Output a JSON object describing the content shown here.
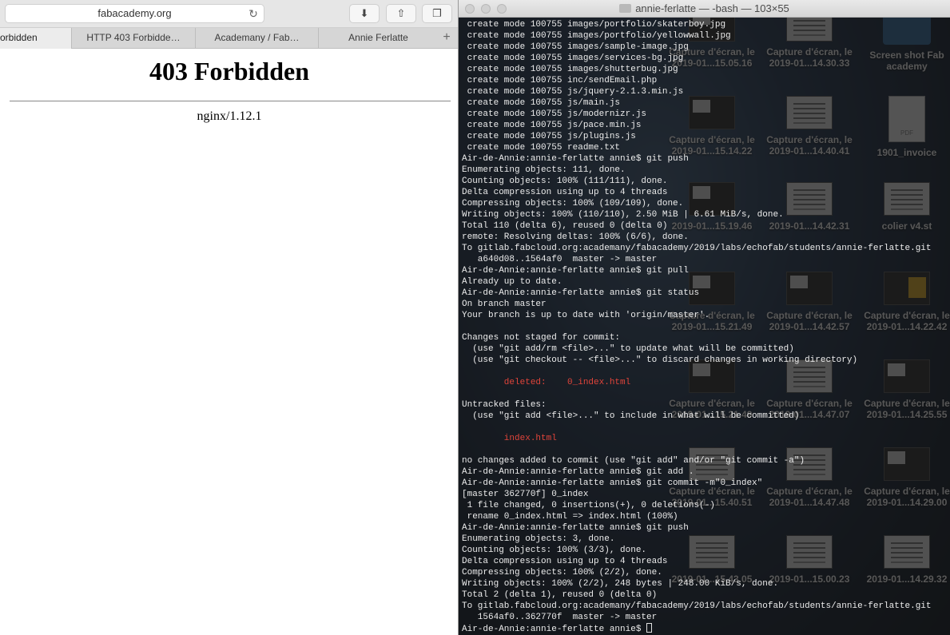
{
  "browser": {
    "address": "fabacademy.org",
    "tabs": [
      {
        "label": "orbidden",
        "active": true
      },
      {
        "label": "HTTP 403 Forbidde…",
        "active": false
      },
      {
        "label": "Academany / Fab…",
        "active": false
      },
      {
        "label": "Annie Ferlatte",
        "active": false
      }
    ],
    "add_tab": "+",
    "page": {
      "title": "403 Forbidden",
      "server": "nginx/1.12.1"
    }
  },
  "terminal": {
    "title": "annie-ferlatte — -bash — 103×55",
    "lines": [
      {
        "text": " create mode 100755 images/portfolio/skaterboy.jpg"
      },
      {
        "text": " create mode 100755 images/portfolio/yellowwall.jpg"
      },
      {
        "text": " create mode 100755 images/sample-image.jpg"
      },
      {
        "text": " create mode 100755 images/services-bg.jpg"
      },
      {
        "text": " create mode 100755 images/shutterbug.jpg"
      },
      {
        "text": " create mode 100755 inc/sendEmail.php"
      },
      {
        "text": " create mode 100755 js/jquery-2.1.3.min.js"
      },
      {
        "text": " create mode 100755 js/main.js"
      },
      {
        "text": " create mode 100755 js/modernizr.js"
      },
      {
        "text": " create mode 100755 js/pace.min.js"
      },
      {
        "text": " create mode 100755 js/plugins.js"
      },
      {
        "text": " create mode 100755 readme.txt"
      },
      {
        "text": "Air-de-Annie:annie-ferlatte annie$ git push"
      },
      {
        "text": "Enumerating objects: 111, done."
      },
      {
        "text": "Counting objects: 100% (111/111), done."
      },
      {
        "text": "Delta compression using up to 4 threads"
      },
      {
        "text": "Compressing objects: 100% (109/109), done."
      },
      {
        "text": "Writing objects: 100% (110/110), 2.50 MiB | 6.61 MiB/s, done."
      },
      {
        "text": "Total 110 (delta 6), reused 0 (delta 0)"
      },
      {
        "text": "remote: Resolving deltas: 100% (6/6), done."
      },
      {
        "text": "To gitlab.fabcloud.org:academany/fabacademy/2019/labs/echofab/students/annie-ferlatte.git"
      },
      {
        "text": "   a640d08..1564af0  master -> master"
      },
      {
        "text": "Air-de-Annie:annie-ferlatte annie$ git pull"
      },
      {
        "text": "Already up to date."
      },
      {
        "text": "Air-de-Annie:annie-ferlatte annie$ git status"
      },
      {
        "text": "On branch master"
      },
      {
        "text": "Your branch is up to date with 'origin/master'."
      },
      {
        "text": ""
      },
      {
        "text": "Changes not staged for commit:"
      },
      {
        "text": "  (use \"git add/rm <file>...\" to update what will be committed)"
      },
      {
        "text": "  (use \"git checkout -- <file>...\" to discard changes in working directory)"
      },
      {
        "text": ""
      },
      {
        "text": "        deleted:    0_index.html",
        "red": true
      },
      {
        "text": ""
      },
      {
        "text": "Untracked files:"
      },
      {
        "text": "  (use \"git add <file>...\" to include in what will be committed)"
      },
      {
        "text": ""
      },
      {
        "text": "        index.html",
        "red": true
      },
      {
        "text": ""
      },
      {
        "text": "no changes added to commit (use \"git add\" and/or \"git commit -a\")"
      },
      {
        "text": "Air-de-Annie:annie-ferlatte annie$ git add ."
      },
      {
        "text": "Air-de-Annie:annie-ferlatte annie$ git commit -m\"0_index\""
      },
      {
        "text": "[master 362770f] 0_index"
      },
      {
        "text": " 1 file changed, 0 insertions(+), 0 deletions(-)"
      },
      {
        "text": " rename 0_index.html => index.html (100%)"
      },
      {
        "text": "Air-de-Annie:annie-ferlatte annie$ git push"
      },
      {
        "text": "Enumerating objects: 3, done."
      },
      {
        "text": "Counting objects: 100% (3/3), done."
      },
      {
        "text": "Delta compression using up to 4 threads"
      },
      {
        "text": "Compressing objects: 100% (2/2), done."
      },
      {
        "text": "Writing objects: 100% (2/2), 248 bytes | 248.00 KiB/s, done."
      },
      {
        "text": "Total 2 (delta 1), reused 0 (delta 0)"
      },
      {
        "text": "To gitlab.fabcloud.org:academany/fabacademy/2019/labs/echofab/students/annie-ferlatte.git"
      },
      {
        "text": "   1564af0..362770f  master -> master"
      },
      {
        "text": "Air-de-Annie:annie-ferlatte annie$ "
      }
    ]
  },
  "desktop": {
    "icons": [
      {
        "label": "Capture d'écran, le 2019-01...15.05.16",
        "kind": "dark"
      },
      {
        "label": "Capture d'écran, le 2019-01...14.30.33",
        "kind": "white"
      },
      {
        "label": "Screen shot Fab academy",
        "kind": "folder"
      },
      {
        "label": "Capture d'écran, le 2019-01...15.14.22",
        "kind": "dark"
      },
      {
        "label": "Capture d'écran, le 2019-01...14.40.41",
        "kind": "white"
      },
      {
        "label": "1901_invoice",
        "kind": "pdf",
        "pdf_mark": "PDF"
      },
      {
        "label": "2019-01...15.19.46",
        "kind": "dark"
      },
      {
        "label": "2019-01...14.42.31",
        "kind": "white"
      },
      {
        "label": "colier v4.st",
        "kind": "white"
      },
      {
        "label": "Capture d'écran, le 2019-01...15.21.49",
        "kind": "dark"
      },
      {
        "label": "Capture d'écran, le 2019-01...14.42.57",
        "kind": "dark"
      },
      {
        "label": "Capture d'écran, le 2019-01...14.22.42",
        "kind": "yellow"
      },
      {
        "label": "Capture d'écran, le 2019-01...15.21.49",
        "kind": "dark"
      },
      {
        "label": "Capture d'écran, le 2019-01...14.47.07",
        "kind": "white"
      },
      {
        "label": "Capture d'écran, le 2019-01...14.25.55",
        "kind": "dark"
      },
      {
        "label": "Capture d'écran, le 2019-01...15.40.51",
        "kind": "white"
      },
      {
        "label": "Capture d'écran, le 2019-01...14.47.48",
        "kind": "white"
      },
      {
        "label": "Capture d'écran, le 2019-01...14.29.00",
        "kind": "dark"
      },
      {
        "label": "2019-01...15.43.05",
        "kind": "white"
      },
      {
        "label": "2019-01...15.00.23",
        "kind": "white"
      },
      {
        "label": "2019-01...14.29.32",
        "kind": "white"
      }
    ]
  }
}
